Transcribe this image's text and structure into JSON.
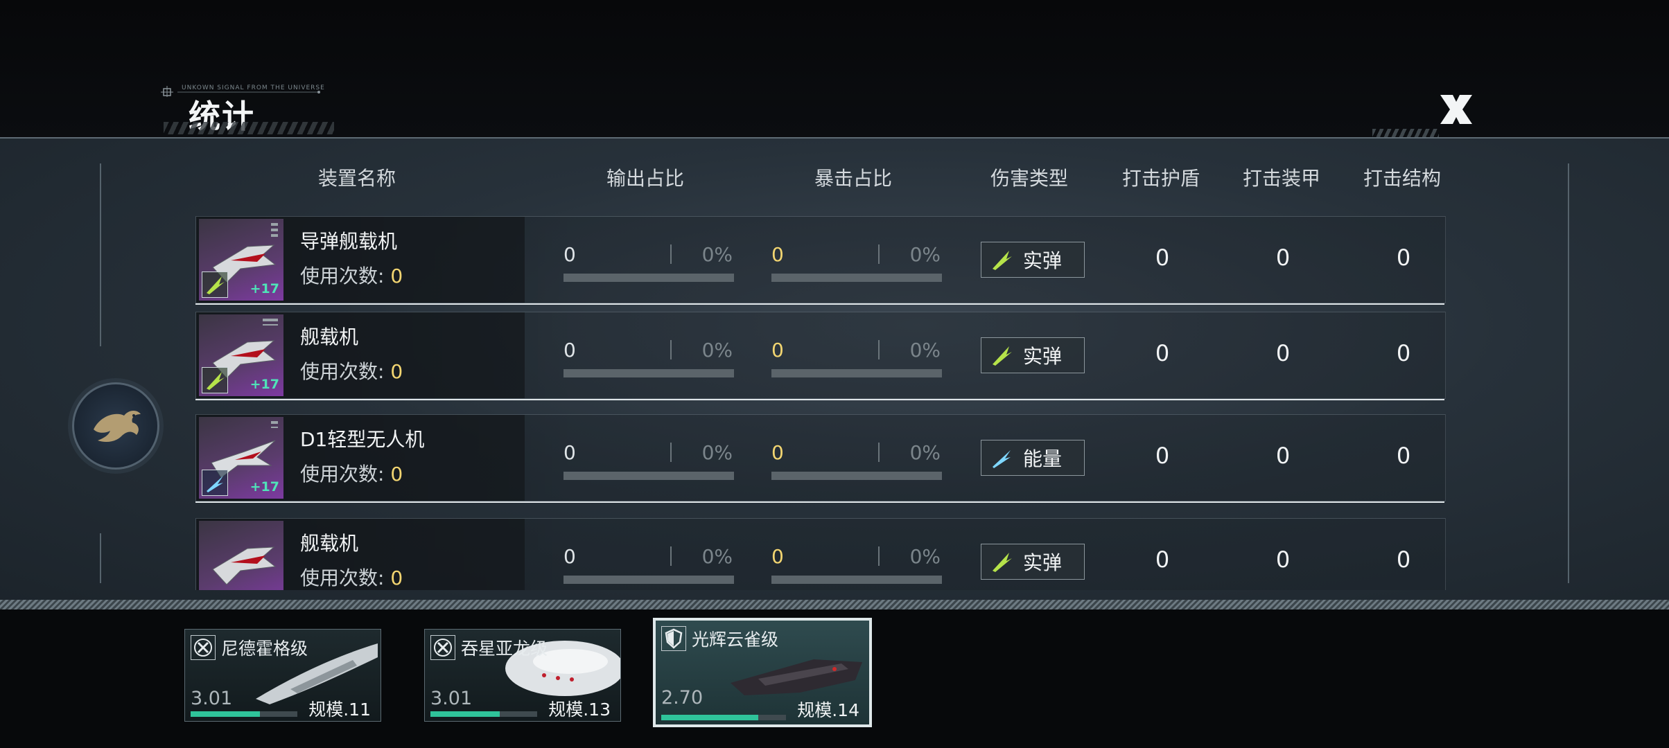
{
  "window": {
    "title": "统计",
    "tagline": "UNKOWN SIGNAL FROM THE UNIVERSE",
    "close_label": "X"
  },
  "columns": [
    "装置名称",
    "输出占比",
    "暴击占比",
    "伤害类型",
    "打击护盾",
    "打击装甲",
    "打击结构"
  ],
  "use_label": "使用次数: ",
  "rows": [
    {
      "name": "导弹舰载机",
      "uses": "0",
      "out_value": "0",
      "out_pct": "0%",
      "crit_value": "0",
      "crit_pct": "0%",
      "damage_type": "实弹",
      "damage_icon": "kinetic-icon",
      "shield": "0",
      "armor": "0",
      "structure": "0",
      "level": "+17"
    },
    {
      "name": "舰载机",
      "uses": "0",
      "out_value": "0",
      "out_pct": "0%",
      "crit_value": "0",
      "crit_pct": "0%",
      "damage_type": "实弹",
      "damage_icon": "kinetic-icon",
      "shield": "0",
      "armor": "0",
      "structure": "0",
      "level": "+17"
    },
    {
      "name": "D1轻型无人机",
      "uses": "0",
      "out_value": "0",
      "out_pct": "0%",
      "crit_value": "0",
      "crit_pct": "0%",
      "damage_type": "能量",
      "damage_icon": "energy-icon",
      "shield": "0",
      "armor": "0",
      "structure": "0",
      "level": "+17"
    },
    {
      "name": "舰载机",
      "uses": "0",
      "out_value": "0",
      "out_pct": "0%",
      "crit_value": "0",
      "crit_pct": "0%",
      "damage_type": "实弹",
      "damage_icon": "kinetic-icon",
      "shield": "0",
      "armor": "0",
      "structure": "0",
      "level": ""
    }
  ],
  "ships": [
    {
      "name": "尼德霍格级",
      "cost": "3.01",
      "scale": "规模.11",
      "selected": false,
      "progress": 0.65
    },
    {
      "name": "吞星亚龙级",
      "cost": "3.01",
      "scale": "规模.13",
      "selected": false,
      "progress": 0.65
    },
    {
      "name": "光辉云雀级",
      "cost": "2.70",
      "scale": "规模.14",
      "selected": true,
      "progress": 0.78
    }
  ],
  "colors": {
    "accent_yellow": "#f2d571",
    "level_green": "#4fe3b8",
    "progress_teal": "#2fc39a"
  }
}
